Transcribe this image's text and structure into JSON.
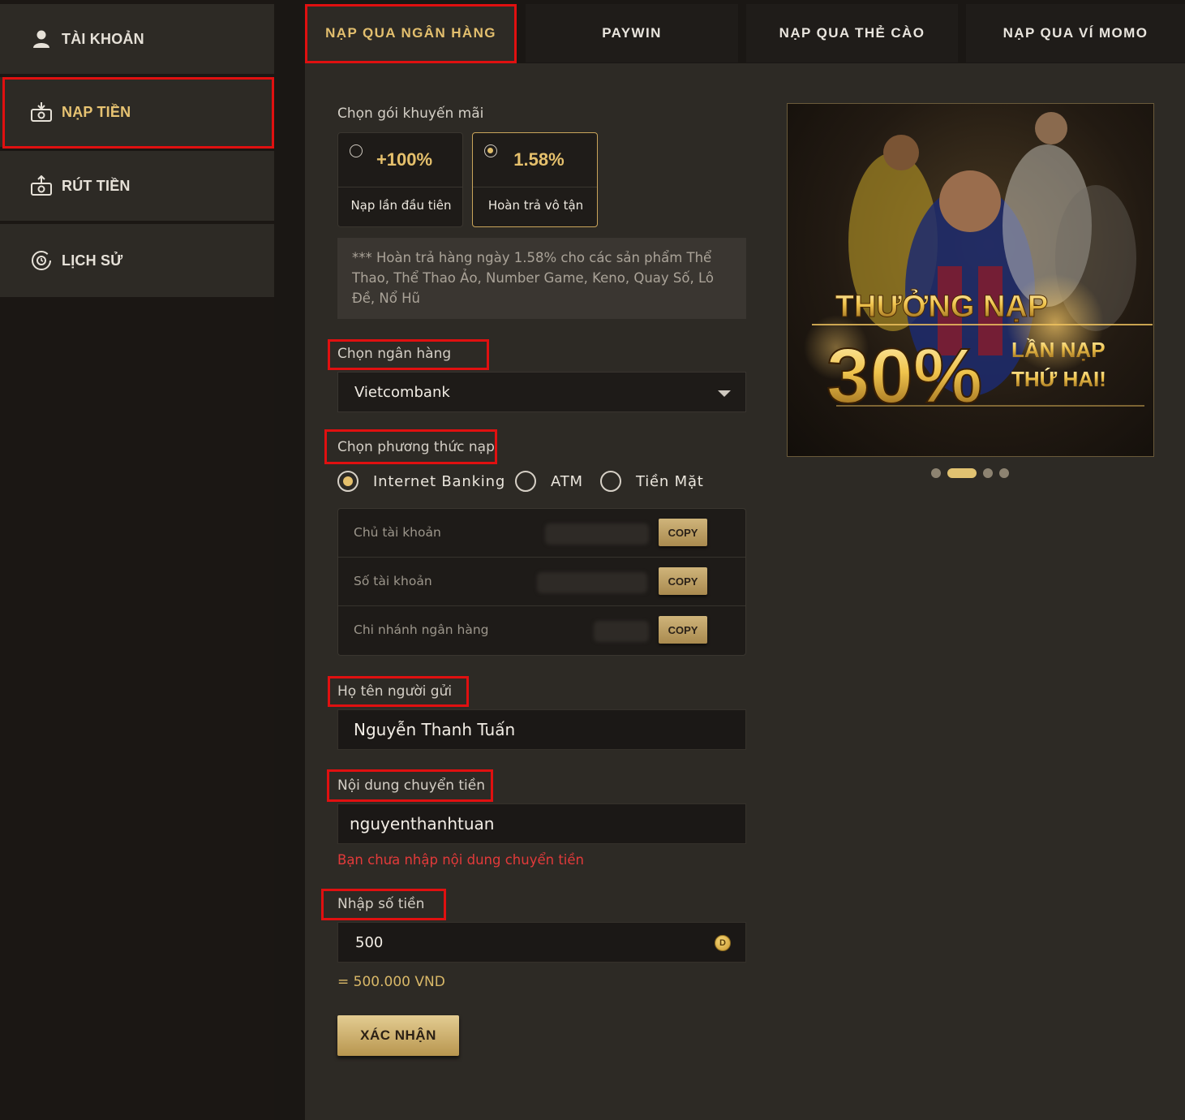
{
  "sidebar": {
    "items": [
      {
        "label": "TÀI KHOẢN",
        "icon": "user-icon"
      },
      {
        "label": "NẠP TIỀN",
        "icon": "deposit-icon",
        "active": true
      },
      {
        "label": "RÚT TIỀN",
        "icon": "withdraw-icon"
      },
      {
        "label": "LỊCH SỬ",
        "icon": "history-icon"
      }
    ]
  },
  "tabs": [
    {
      "label": "NẠP QUA NGÂN HÀNG",
      "active": true
    },
    {
      "label": "PAYWIN"
    },
    {
      "label": "NẠP QUA THẺ CÀO"
    },
    {
      "label": "NẠP QUA VÍ MOMO"
    }
  ],
  "promo": {
    "label": "Chọn gói khuyến mãi",
    "options": [
      {
        "value": "+100%",
        "desc": "Nạp lần đầu tiên",
        "selected": false
      },
      {
        "value": "1.58%",
        "desc": "Hoàn trả vô tận",
        "selected": true
      }
    ],
    "note": "*** Hoàn trả hàng ngày 1.58% cho các sản phẩm Thể Thao, Thể Thao Ảo, Number Game, Keno, Quay Số, Lô Đề, Nổ Hũ"
  },
  "bank": {
    "label": "Chọn ngân hàng",
    "selected": "Vietcombank"
  },
  "method": {
    "label": "Chọn phương thức nạp",
    "options": [
      {
        "label": "Internet Banking",
        "selected": true
      },
      {
        "label": "ATM",
        "selected": false
      },
      {
        "label": "Tiền Mặt",
        "selected": false
      }
    ]
  },
  "account_info": {
    "rows": [
      {
        "key": "Chủ tài khoản",
        "copy": "COPY"
      },
      {
        "key": "Số tài khoản",
        "copy": "COPY"
      },
      {
        "key": "Chi nhánh ngân hàng",
        "copy": "COPY"
      }
    ]
  },
  "sender": {
    "label": "Họ tên người gửi",
    "value": "Nguyễn Thanh Tuấn"
  },
  "content": {
    "label": "Nội dung chuyển tiền",
    "value": "nguyenthanhtuan",
    "error": "Bạn chưa nhập nội dung chuyển tiền"
  },
  "amount": {
    "label": "Nhập số tiền",
    "value": "500",
    "coin_symbol": "D",
    "converted": "= 500.000 VND"
  },
  "confirm_label": "XÁC NHẬN",
  "banner": {
    "headline": "THƯỞNG NẠP",
    "percent": "30%",
    "line1": "LẦN NẠP",
    "line2": "THỨ HAI!",
    "slides": 4,
    "active_slide": 2
  },
  "colors": {
    "accent": "#e3bf6e",
    "panel": "#2d2a25",
    "error": "#e23a3a",
    "highlight_box": "#e01010"
  }
}
